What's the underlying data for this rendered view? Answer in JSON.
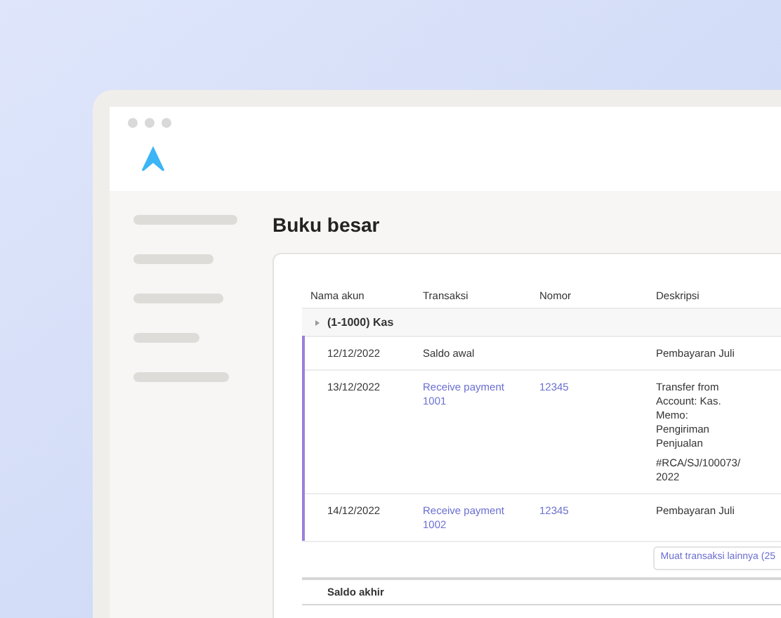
{
  "page_title": "Buku besar",
  "table": {
    "columns": [
      "Nama akun",
      "Transaksi",
      "Nomor",
      "Deskripsi"
    ],
    "group": {
      "label": "(1-1000) Kas",
      "expanded": false
    },
    "rows": [
      {
        "date": "12/12/2022",
        "transaction": "Saldo awal",
        "transaction_link": false,
        "number": "",
        "description": [
          "Pembayaran Juli"
        ]
      },
      {
        "date": "13/12/2022",
        "transaction": "Receive payment 1001",
        "transaction_link": true,
        "number": "12345",
        "description": [
          "Transfer from Account: Kas. Memo: Pengiriman Penjualan",
          "#RCA/SJ/100073/2022"
        ]
      },
      {
        "date": "14/12/2022",
        "transaction": "Receive payment 1002",
        "transaction_link": true,
        "number": "12345",
        "description": [
          "Pembayaran Juli"
        ]
      }
    ],
    "load_more": "Muat transaksi lainnya (25",
    "footer_label": "Saldo akhir"
  }
}
